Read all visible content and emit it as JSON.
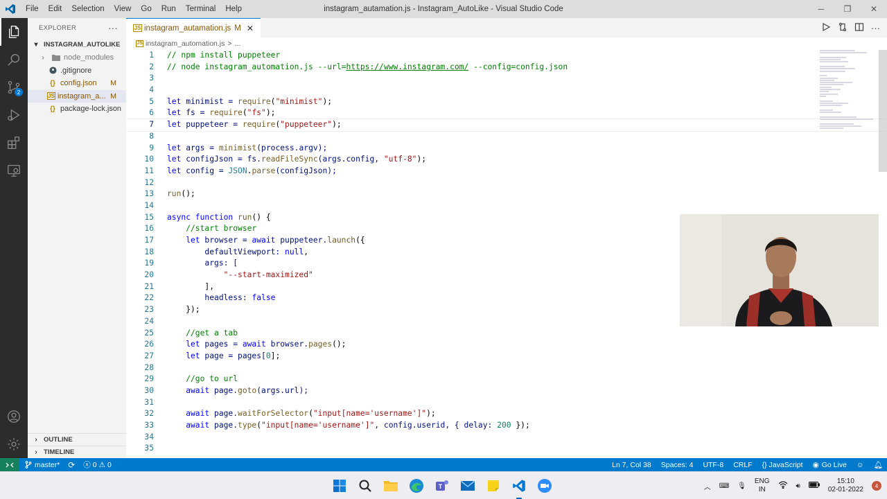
{
  "titlebar": {
    "menu": [
      "File",
      "Edit",
      "Selection",
      "View",
      "Go",
      "Run",
      "Terminal",
      "Help"
    ],
    "window_title": "instagram_autamation.js - Instagram_AutoLike - Visual Studio Code"
  },
  "activity_bar": {
    "items": [
      "explorer-icon",
      "search-icon",
      "source-control-icon",
      "run-debug-icon",
      "extensions-icon",
      "remote-explorer-icon"
    ],
    "source_control_badge": "2",
    "bottom": [
      "account-icon",
      "manage-gear-icon"
    ]
  },
  "sidebar": {
    "title": "EXPLORER",
    "more": "···",
    "folder": "INSTAGRAM_AUTOLIKE",
    "files": [
      {
        "name": "node_modules",
        "icon": "folder",
        "modified": ""
      },
      {
        "name": ".gitignore",
        "icon": "git",
        "modified": ""
      },
      {
        "name": "config.json",
        "icon": "json",
        "modified": "M"
      },
      {
        "name": "instagram_a...",
        "icon": "js",
        "modified": "M"
      },
      {
        "name": "package-lock.json",
        "icon": "json",
        "modified": ""
      }
    ],
    "outline": "OUTLINE",
    "timeline": "TIMELINE"
  },
  "editor": {
    "tab": {
      "icon": "JS",
      "label": "instagram_autamation.js",
      "modified": "M",
      "close": "✕"
    },
    "breadcrumb": {
      "file": "instagram_automation.js",
      "sep": ">",
      "rest": "..."
    },
    "current_line": 7
  },
  "code_lines": [
    "1",
    "2",
    "3",
    "4",
    "5",
    "6",
    "7",
    "8",
    "9",
    "10",
    "11",
    "12",
    "13",
    "14",
    "15",
    "16",
    "17",
    "18",
    "19",
    "20",
    "21",
    "22",
    "23",
    "24",
    "25",
    "26",
    "27",
    "28",
    "29",
    "30",
    "31",
    "32",
    "33",
    "34",
    "35"
  ],
  "code": {
    "l1": "// npm install puppeteer",
    "l2a": "// node instagram_automation.js --url=",
    "l2b": "https://www.instagram.com/",
    "l2c": " --config=config.json",
    "l5a": "let",
    "l5b": " minimist = ",
    "l5c": "require",
    "l5d": "(",
    "l5e": "\"minimist\"",
    "l5f": ");",
    "l6a": "let",
    "l6b": " fs = ",
    "l6c": "require",
    "l6d": "(",
    "l6e": "\"fs\"",
    "l6f": ");",
    "l7a": "let",
    "l7b": " puppeteer = ",
    "l7c": "require",
    "l7d": "(",
    "l7e": "\"puppeteer\"",
    "l7f": ");",
    "l9a": "let",
    "l9b": " args = ",
    "l9c": "minimist",
    "l9d": "(process.argv);",
    "l10a": "let",
    "l10b": " configJson = fs.",
    "l10c": "readFileSync",
    "l10d": "(args.config, ",
    "l10e": "\"utf-8\"",
    "l10f": ");",
    "l11a": "let",
    "l11b": " config = ",
    "l11c": "JSON",
    "l11d": ".",
    "l11e": "parse",
    "l11f": "(configJson);",
    "l13a": "run",
    "l13b": "();",
    "l15a": "async function",
    "l15b": " ",
    "l15c": "run",
    "l15d": "() {",
    "l16": "    //start browser",
    "l17a": "    let",
    "l17b": " browser = ",
    "l17c": "await",
    "l17d": " puppeteer.",
    "l17e": "launch",
    "l17f": "({",
    "l18a": "        defaultViewport: ",
    "l18b": "null",
    "l18c": ",",
    "l19a": "        args: [",
    "l20": "            \"--start-maximized\"",
    "l21": "        ],",
    "l22a": "        headless: ",
    "l22b": "false",
    "l23": "    });",
    "l25": "    //get a tab",
    "l26a": "    let",
    "l26b": " pages = ",
    "l26c": "await",
    "l26d": " browser.",
    "l26e": "pages",
    "l26f": "();",
    "l27a": "    let",
    "l27b": " page = pages[",
    "l27c": "0",
    "l27d": "];",
    "l29": "    //go to url",
    "l30a": "    await",
    "l30b": " page.",
    "l30c": "goto",
    "l30d": "(args.url);",
    "l32a": "    await",
    "l32b": " page.",
    "l32c": "waitForSelector",
    "l32d": "(",
    "l32e": "\"input[name='username']\"",
    "l32f": ");",
    "l33a": "    await",
    "l33b": " page.",
    "l33c": "type",
    "l33d": "(",
    "l33e": "\"input[name='username']\"",
    "l33f": ", config.userid, { delay: ",
    "l33g": "200",
    "l33h": " });"
  },
  "statusbar": {
    "remote": "><",
    "branch": "master*",
    "sync": "⟳",
    "errors": "0",
    "warnings": "0",
    "position": "Ln 7, Col 38",
    "spaces": "Spaces: 4",
    "encoding": "UTF-8",
    "eol": "CRLF",
    "language": "{} JavaScript",
    "golive": "Go Live"
  },
  "taskbar": {
    "apps": [
      "windows-start-icon",
      "search-icon",
      "file-explorer-icon",
      "edge-icon",
      "teams-icon",
      "mail-icon",
      "sticky-notes-icon",
      "vscode-icon",
      "zoom-icon"
    ],
    "lang_top": "ENG",
    "lang_bottom": "IN",
    "time": "15:10",
    "date": "02-01-2022",
    "notifications": "4"
  }
}
